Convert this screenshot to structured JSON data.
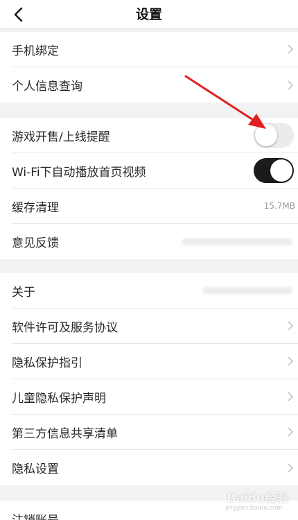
{
  "header": {
    "back_icon": "chevron-left-icon",
    "title": "设置"
  },
  "group1": {
    "items": [
      {
        "label": "手机绑定"
      },
      {
        "label": "个人信息查询"
      }
    ]
  },
  "group2": {
    "items": [
      {
        "label": "游戏开售/上线提醒",
        "toggle": false
      },
      {
        "label": "Wi-Fi下自动播放首页视频",
        "toggle": true
      },
      {
        "label": "缓存清理",
        "value": "15.7MB"
      },
      {
        "label": "意见反馈"
      }
    ]
  },
  "group3": {
    "items": [
      {
        "label": "关于"
      },
      {
        "label": "软件许可及服务协议"
      },
      {
        "label": "隐私保护指引"
      },
      {
        "label": "儿童隐私保护声明"
      },
      {
        "label": "第三方信息共享清单"
      },
      {
        "label": "隐私设置"
      }
    ]
  },
  "group4": {
    "items": [
      {
        "label": "注销账号"
      }
    ]
  },
  "annotation": {
    "color": "#e02020"
  },
  "watermark": {
    "text": "Baidu经验",
    "sub": "jingyan.baidu.com"
  }
}
